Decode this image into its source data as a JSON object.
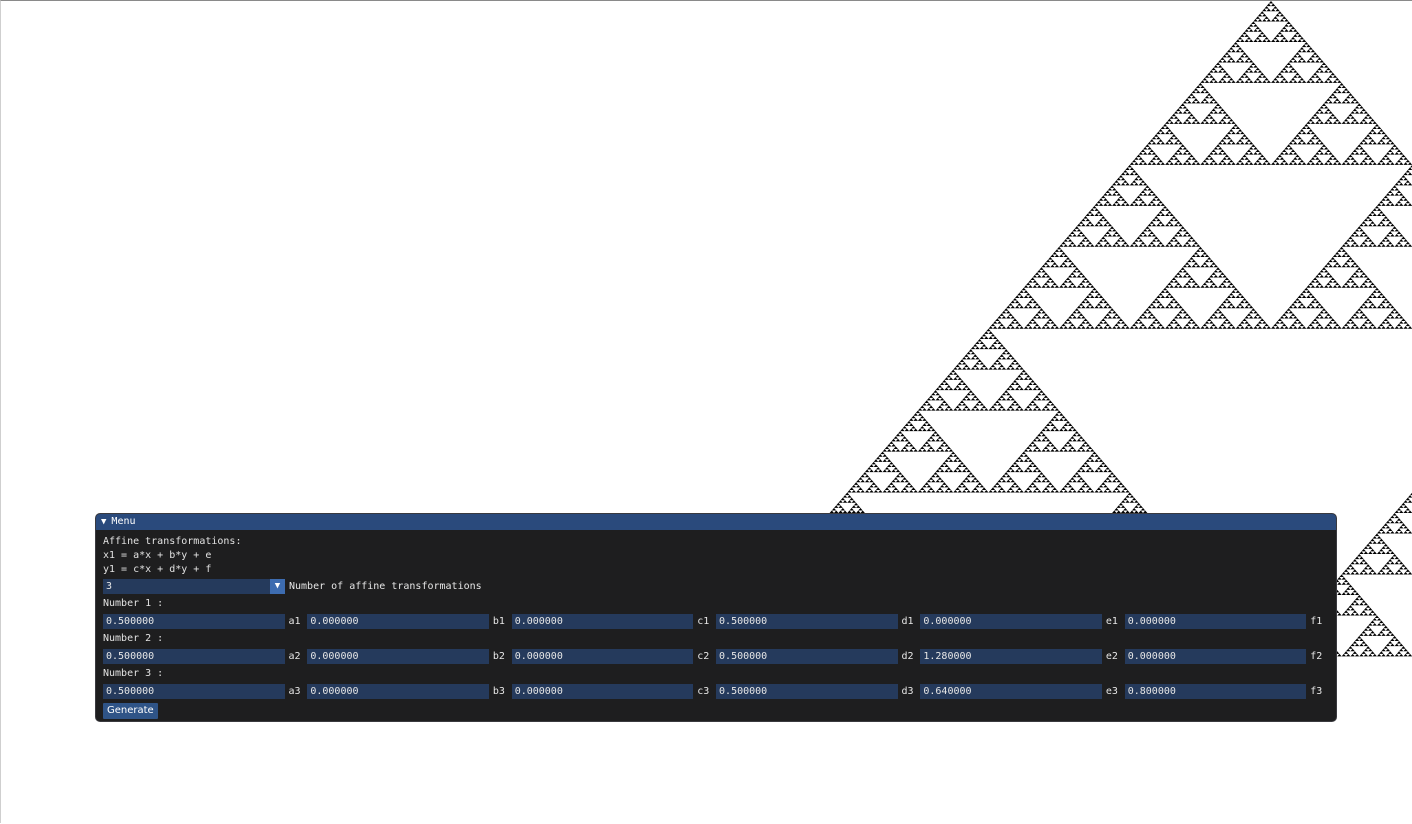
{
  "menu": {
    "title": "Menu",
    "lines": [
      "Affine transformations:",
      "x1 = a*x + b*y + e",
      "y1 = c*x + d*y + f"
    ],
    "transform_count": {
      "value": "3",
      "label": "Number of affine transformations"
    },
    "transforms": [
      {
        "label": "Number 1 :",
        "fields": [
          {
            "value": "0.500000",
            "label": "a1"
          },
          {
            "value": "0.000000",
            "label": "b1"
          },
          {
            "value": "0.000000",
            "label": "c1"
          },
          {
            "value": "0.500000",
            "label": "d1"
          },
          {
            "value": "0.000000",
            "label": "e1"
          },
          {
            "value": "0.000000",
            "label": "f1"
          }
        ]
      },
      {
        "label": "Number 2 :",
        "fields": [
          {
            "value": "0.500000",
            "label": "a2"
          },
          {
            "value": "0.000000",
            "label": "b2"
          },
          {
            "value": "0.000000",
            "label": "c2"
          },
          {
            "value": "0.500000",
            "label": "d2"
          },
          {
            "value": "1.280000",
            "label": "e2"
          },
          {
            "value": "0.000000",
            "label": "f2"
          }
        ]
      },
      {
        "label": "Number 3 :",
        "fields": [
          {
            "value": "0.500000",
            "label": "a3"
          },
          {
            "value": "0.000000",
            "label": "b3"
          },
          {
            "value": "0.000000",
            "label": "c3"
          },
          {
            "value": "0.500000",
            "label": "d3"
          },
          {
            "value": "0.640000",
            "label": "e3"
          },
          {
            "value": "0.800000",
            "label": "f3"
          }
        ]
      }
    ],
    "generate_label": "Generate"
  },
  "icons": {
    "collapse": "triangle-down-icon",
    "combo_arrow": "triangle-down-icon"
  },
  "colors": {
    "title_bar": "#2a4a7c",
    "window_bg": "#1e1e1f",
    "field_bg": "#253a5c",
    "button_bg": "#2f5487",
    "fractal": "#000000",
    "canvas_bg": "#ffffff"
  }
}
